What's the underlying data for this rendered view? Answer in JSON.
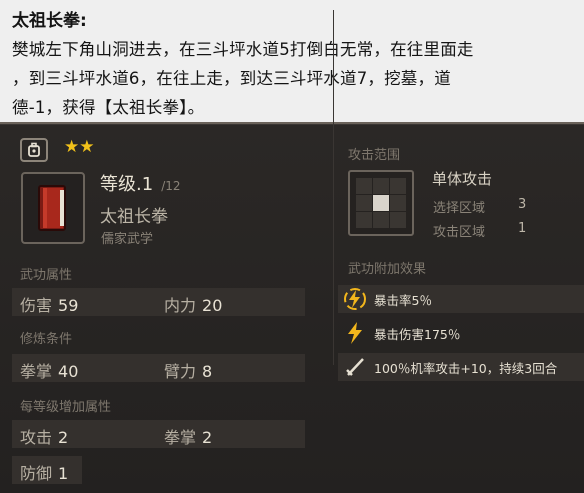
{
  "note": {
    "title": "太祖长拳:",
    "line1": "樊城左下角山洞进去，在三斗坪水道5打倒白无常，在往里面走",
    "line2": "，到三斗坪水道6，在往上走，到达三斗坪水道7，挖墓，道",
    "line3": "德-1，获得【太祖长拳】。"
  },
  "skill": {
    "stars": "★★",
    "level": "等级.1",
    "level_max": "/12",
    "name": "太祖长拳",
    "school": "儒家武学"
  },
  "attributes": {
    "label": "武功属性",
    "damage_key": "伤害",
    "damage_val": "59",
    "inner_key": "内力",
    "inner_val": "20"
  },
  "requirements": {
    "label": "修炼条件",
    "fist_key": "拳掌",
    "fist_val": "40",
    "arm_key": "臂力",
    "arm_val": "8"
  },
  "per_level": {
    "label": "每等级增加属性",
    "attack_key": "攻击",
    "attack_val": "2",
    "fist_key": "拳掌",
    "fist_val": "2",
    "defense_key": "防御",
    "defense_val": "1"
  },
  "range": {
    "label": "攻击范围",
    "type": "单体攻击",
    "select_key": "选择区域",
    "select_val": "3",
    "attack_key": "攻击区域",
    "attack_val": "1"
  },
  "effects": {
    "label": "武功附加效果",
    "items": [
      {
        "icon": "lightning-circle-icon",
        "text": "暴击率5％"
      },
      {
        "icon": "lightning-icon",
        "text": "暴击伤害175％"
      },
      {
        "icon": "sword-icon",
        "text": "100％机率攻击+10，持续3回合"
      }
    ]
  },
  "colors": {
    "star": "#f2c21a",
    "accent": "#f2b61c",
    "panel": "#2b2826",
    "note_bg": "#efefef"
  }
}
